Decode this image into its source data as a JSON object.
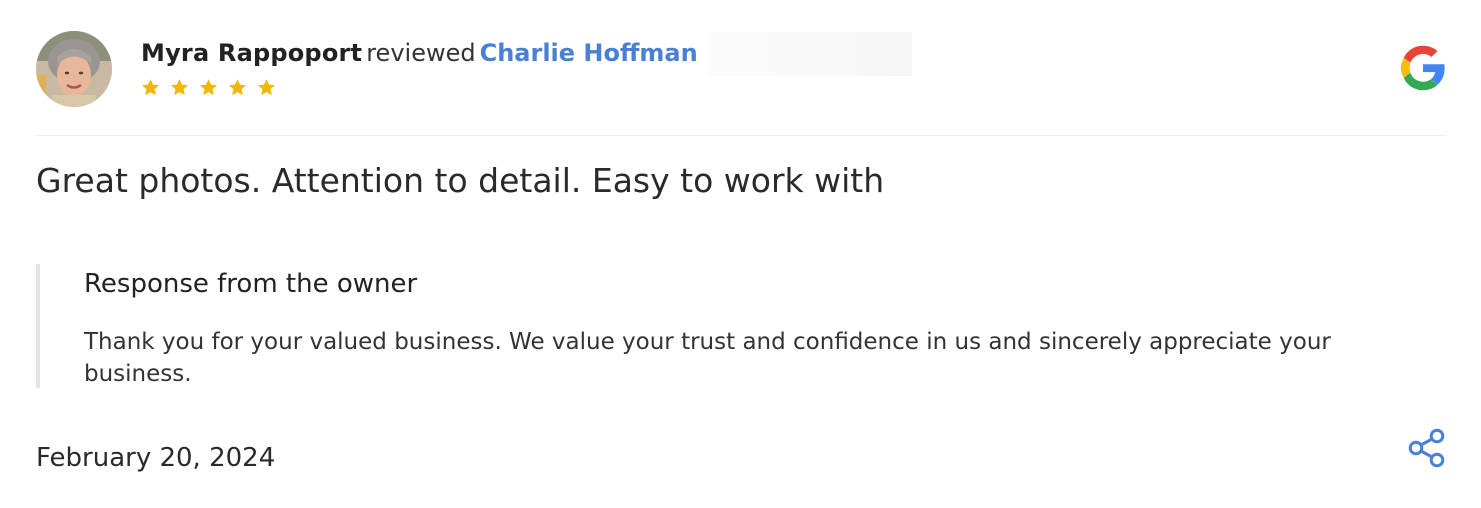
{
  "review": {
    "reviewer_name": "Myra Rappoport",
    "reviewed_word": "reviewed",
    "business_name": "Charlie Hoffman",
    "rating": 5,
    "rating_max": 5,
    "star_color": "#f2b705",
    "text": "Great photos. Attention to detail. Easy to work with",
    "date": "February 20, 2024"
  },
  "owner_response": {
    "title": "Response from the owner",
    "body": "Thank you for your valued business. We value your trust and confidence in us and sincerely appreciate your business."
  },
  "icons": {
    "platform": "google-icon",
    "share": "share-icon",
    "star": "star-icon"
  },
  "colors": {
    "link": "#4a7fd6",
    "share": "#4a7fd6"
  }
}
